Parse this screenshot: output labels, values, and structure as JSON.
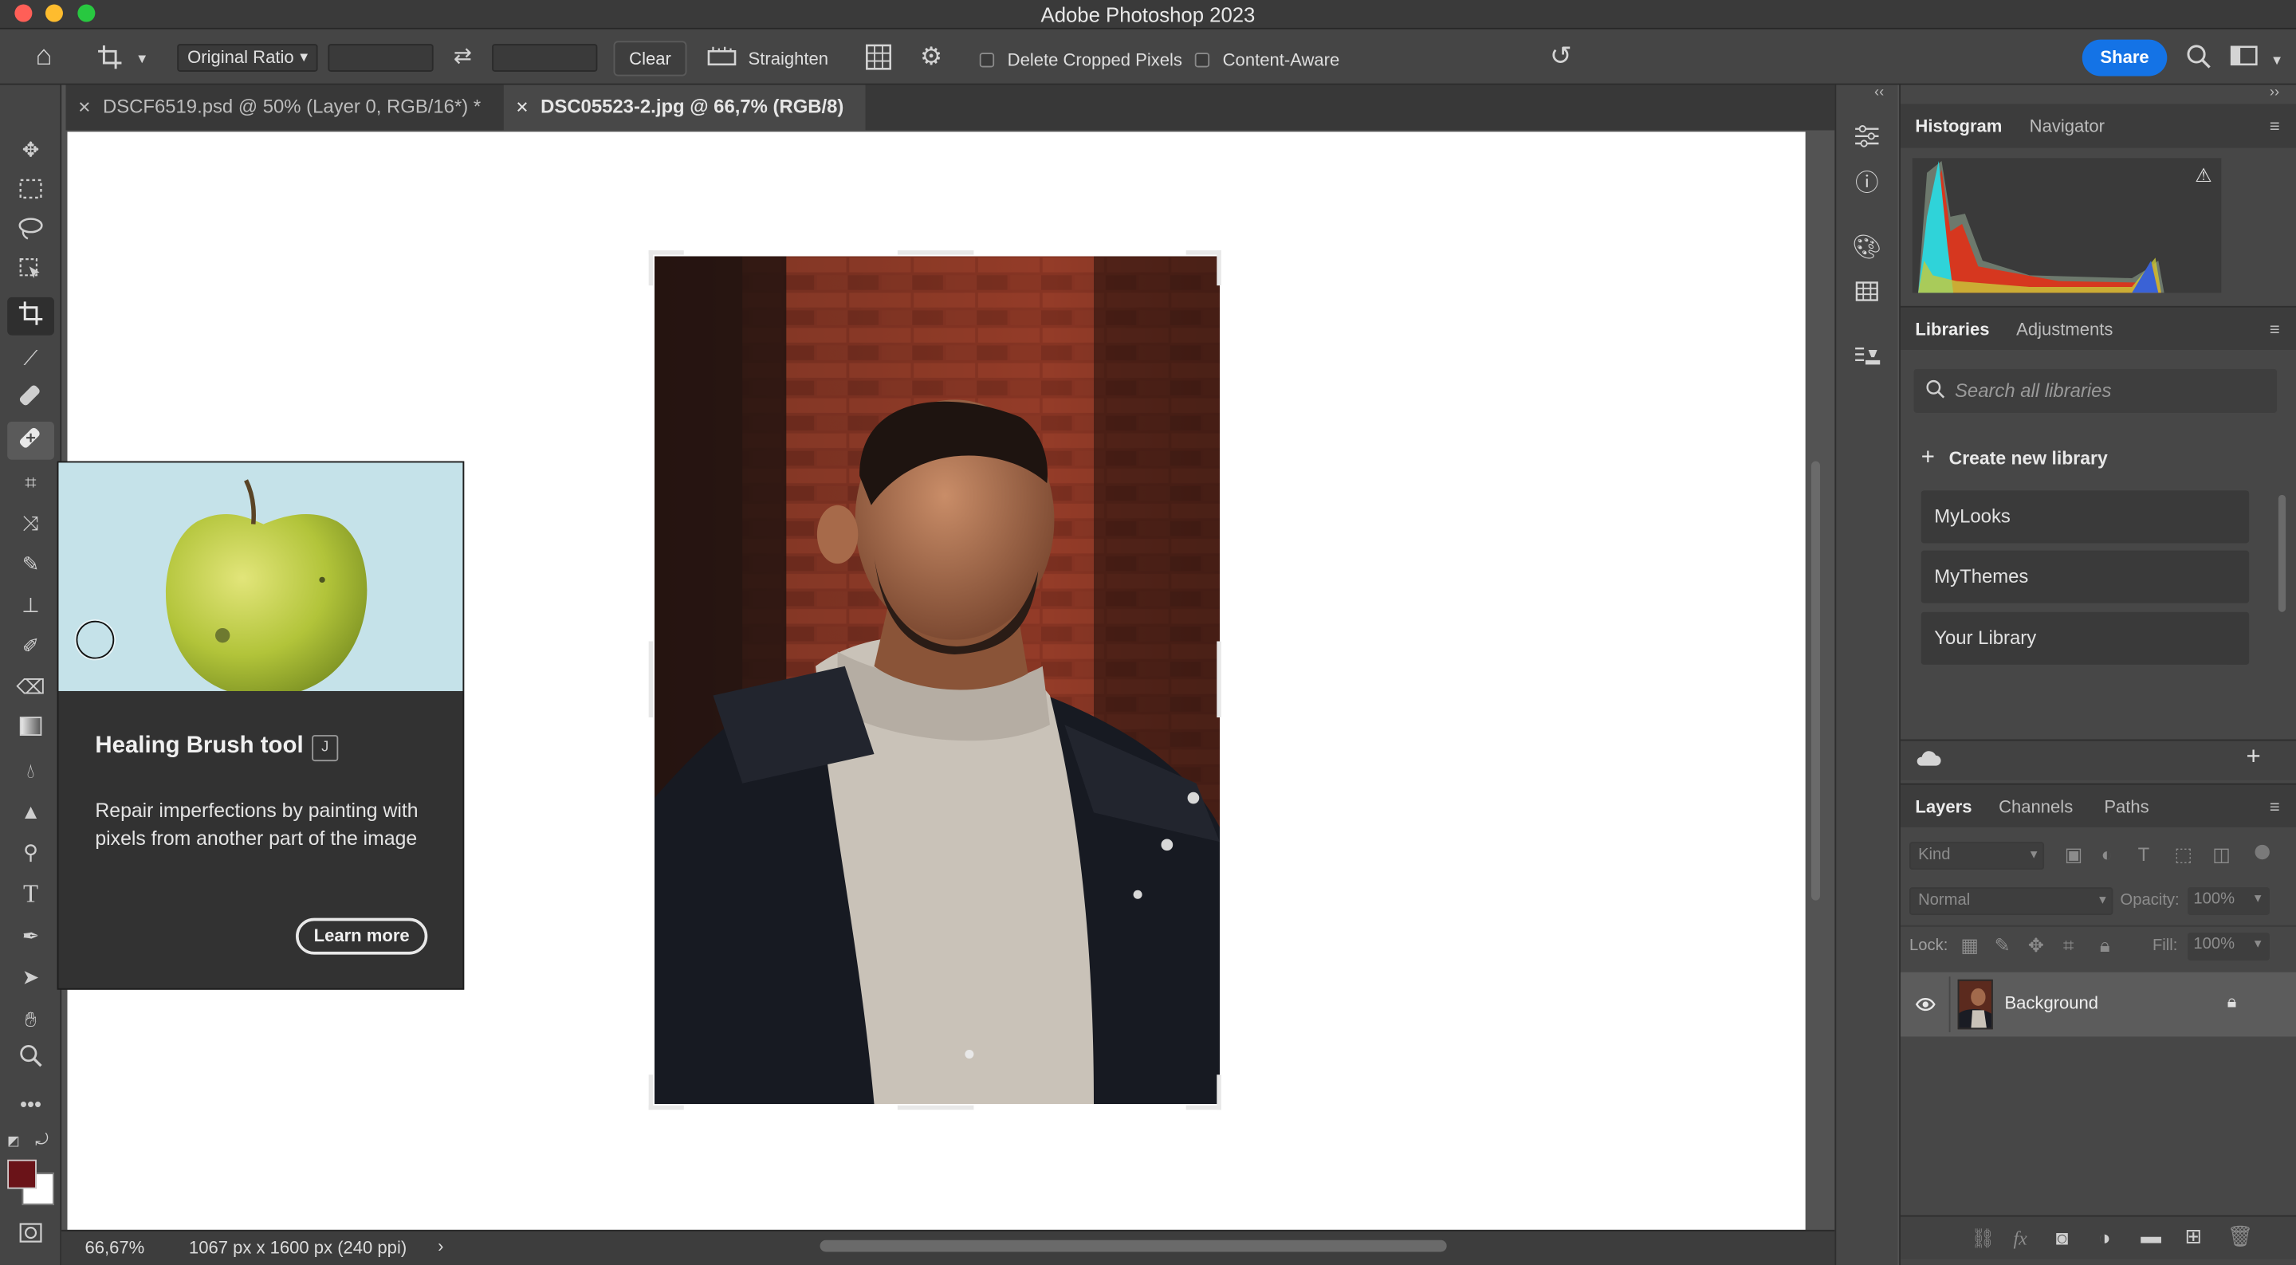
{
  "window": {
    "title": "Adobe Photoshop 2023",
    "traffic_colors": [
      "#ff5f57",
      "#febc2e",
      "#28c840"
    ]
  },
  "options_bar": {
    "ratio_select": "Original Ratio",
    "clear_label": "Clear",
    "straighten_label": "Straighten",
    "delete_cropped_label": "Delete Cropped Pixels",
    "content_aware_label": "Content-Aware",
    "share_label": "Share",
    "accent_color": "#1473e6"
  },
  "tabs": [
    {
      "label": "DSCF6519.psd @ 50% (Layer 0, RGB/16*) *",
      "active": false
    },
    {
      "label": "DSC05523-2.jpg @ 66,7% (RGB/8)",
      "active": true
    }
  ],
  "toolbar": {
    "tools": [
      "move-tool",
      "marquee-tool",
      "lasso-tool",
      "object-select-tool",
      "crop-tool",
      "eyedropper-tool",
      "spot-healing-tool",
      "healing-brush-tool",
      "patch-tool",
      "content-aware-move-tool",
      "brush-tool",
      "clone-stamp-tool",
      "history-brush-tool",
      "eraser-tool",
      "gradient-tool",
      "blur-tool",
      "sharpen-tool",
      "dodge-tool",
      "type-tool",
      "pen-tool",
      "path-select-tool",
      "hand-tool",
      "zoom-tool",
      "more-tools"
    ],
    "foreground_color": "#6a1318",
    "background_color": "#ffffff"
  },
  "tooltip": {
    "title": "Healing Brush tool",
    "shortcut": "J",
    "description": "Repair imperfections by painting with pixels from another part of the image",
    "learn_more": "Learn more"
  },
  "status": {
    "zoom": "66,67%",
    "doc_info": "1067 px x 1600 px (240 ppi)"
  },
  "histogram_panel": {
    "tabs": [
      "Histogram",
      "Navigator"
    ]
  },
  "libraries_panel": {
    "tabs": [
      "Libraries",
      "Adjustments"
    ],
    "search_placeholder": "Search all libraries",
    "create_label": "Create new library",
    "items": [
      "MyLooks",
      "MyThemes",
      "Your Library"
    ]
  },
  "layers_panel": {
    "tabs": [
      "Layers",
      "Channels",
      "Paths"
    ],
    "kind_label": "Kind",
    "blend_mode": "Normal",
    "opacity_label": "Opacity:",
    "opacity_value": "100%",
    "lock_label": "Lock:",
    "fill_label": "Fill:",
    "fill_value": "100%",
    "layers": [
      {
        "name": "Background"
      }
    ]
  }
}
